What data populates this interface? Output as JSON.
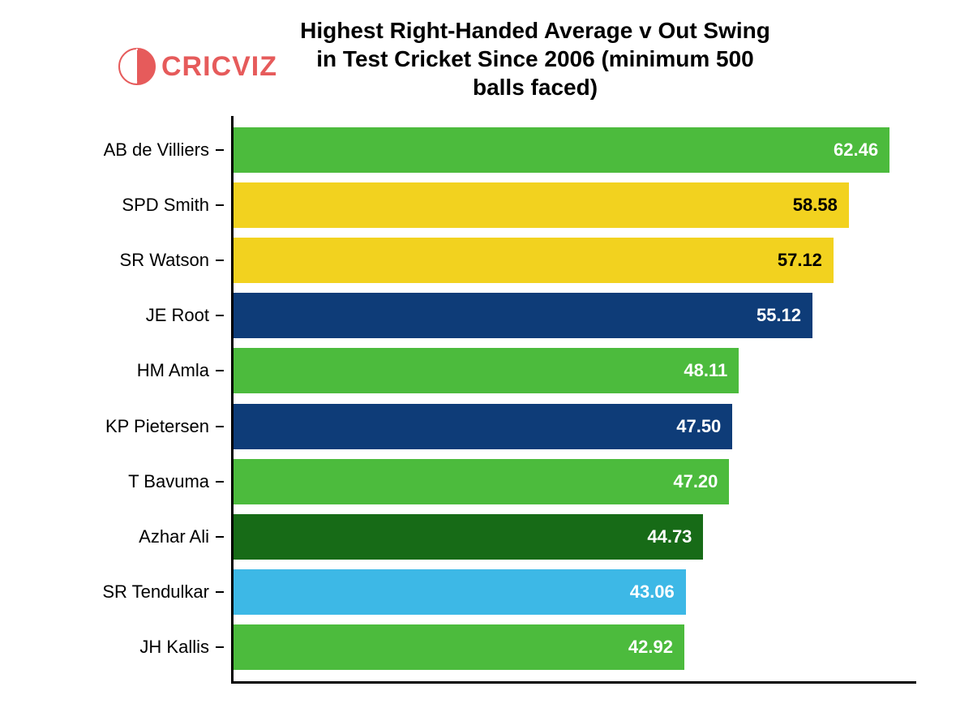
{
  "logo": {
    "text": "CRICVIZ"
  },
  "chart_data": {
    "type": "bar",
    "title": "Highest Right-Handed Average v Out Swing in Test Cricket Since 2006 (minimum 500 balls faced)",
    "xlabel": "",
    "ylabel": "",
    "xlim": [
      0,
      65
    ],
    "categories": [
      "AB de Villiers",
      "SPD Smith",
      "SR Watson",
      "JE Root",
      "HM Amla",
      "KP Pietersen",
      "T Bavuma",
      "Azhar Ali",
      "SR Tendulkar",
      "JH Kallis"
    ],
    "values": [
      62.46,
      58.58,
      57.12,
      55.12,
      48.11,
      47.5,
      47.2,
      44.73,
      43.06,
      42.92
    ],
    "value_labels": [
      "62.46",
      "58.58",
      "57.12",
      "55.12",
      "48.11",
      "47.50",
      "47.20",
      "44.73",
      "43.06",
      "42.92"
    ],
    "colors": [
      "#4cbb3d",
      "#f2d21f",
      "#f2d21f",
      "#0e3c78",
      "#4cbb3d",
      "#0e3c78",
      "#4cbb3d",
      "#176b17",
      "#3db8e6",
      "#4cbb3d"
    ],
    "label_colors": [
      "#ffffff",
      "#000000",
      "#000000",
      "#ffffff",
      "#ffffff",
      "#ffffff",
      "#ffffff",
      "#ffffff",
      "#ffffff",
      "#ffffff"
    ]
  }
}
